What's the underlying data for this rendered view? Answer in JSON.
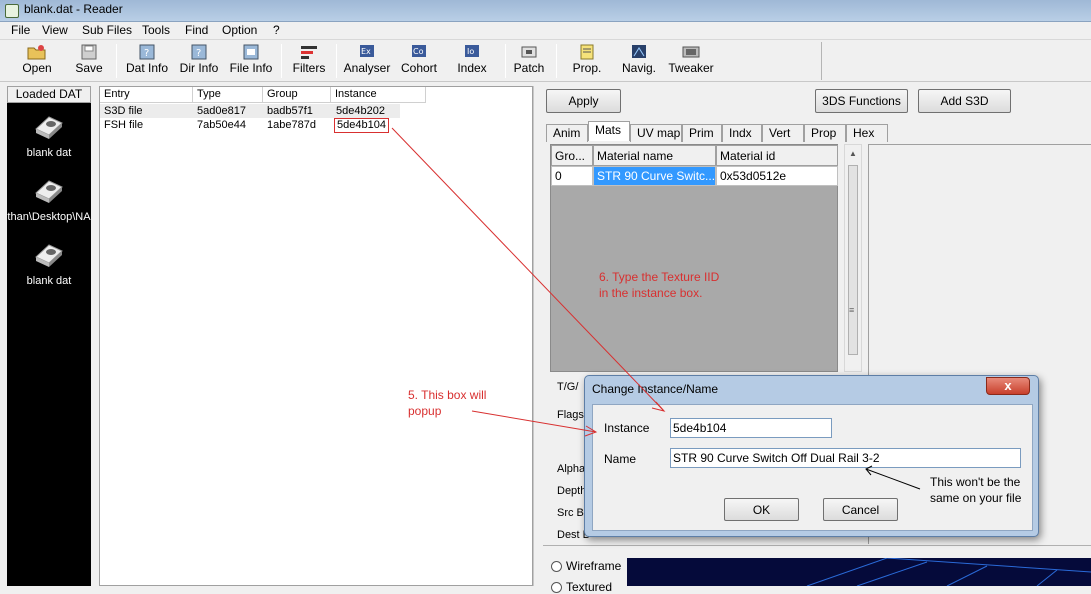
{
  "window": {
    "title": "blank.dat - Reader"
  },
  "menu": [
    "File",
    "View",
    "Sub Files",
    "Tools",
    "Find",
    "Option",
    "?"
  ],
  "toolbar": {
    "open": "Open",
    "save": "Save",
    "dat_info": "Dat Info",
    "dir_info": "Dir Info",
    "file_info": "File Info",
    "filters": "Filters",
    "analyser": "Analyser",
    "cohort": "Cohort",
    "index": "Index",
    "patch": "Patch",
    "prop": "Prop.",
    "navig": "Navig.",
    "tweaker": "Tweaker"
  },
  "left_panel": {
    "header": "Loaded DAT",
    "items": [
      "blank dat",
      "than\\Desktop\\NA",
      "blank dat"
    ]
  },
  "entry_table": {
    "columns": [
      "Entry",
      "Type",
      "Group",
      "Instance"
    ],
    "rows": [
      [
        "S3D file",
        "5ad0e817",
        "badb57f1",
        "5de4b202"
      ],
      [
        "FSH file",
        "7ab50e44",
        "1abe787d",
        "5de4b104"
      ]
    ]
  },
  "right_panel": {
    "apply": "Apply",
    "functions_3ds": "3DS Functions",
    "add_s3d": "Add S3D",
    "tabs": [
      "Anim",
      "Mats",
      "UV map",
      "Prim",
      "Indx",
      "Vert",
      "Prop",
      "Hex"
    ],
    "active_tab": "Mats",
    "grid_columns": [
      "Gro...",
      "Material name",
      "Material id"
    ],
    "grid_row": [
      "0",
      "STR 90 Curve Switc...",
      "0x53d0512e"
    ],
    "side_labels": [
      "T/G/",
      "Flags",
      "Alpha",
      "Depth",
      "Src B",
      "Dest B"
    ],
    "view_options": [
      "Wireframe",
      "Textured"
    ]
  },
  "dialog": {
    "title": "Change Instance/Name",
    "close": "x",
    "instance_label": "Instance",
    "instance_value": "5de4b104",
    "name_label": "Name",
    "name_value": "STR 90 Curve Switch Off Dual Rail 3-2",
    "ok": "OK",
    "cancel": "Cancel"
  },
  "annotations": {
    "step5": "5. This box will popup",
    "step6": "6. Type the Texture IID in the instance box.",
    "note": "This won't be the same on your file"
  },
  "colors": {
    "annotation_red": "#d83030",
    "selection": "#3399ff",
    "dat_panel": "#000000"
  }
}
